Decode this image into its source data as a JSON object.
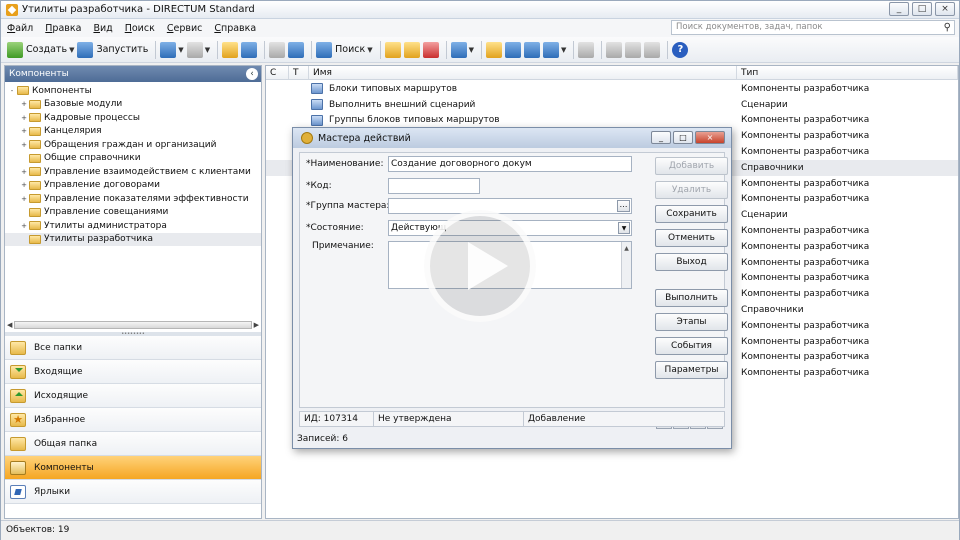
{
  "window": {
    "title": "Утилиты разработчика - DIRECTUM Standard",
    "controls": [
      "_",
      "□",
      "×"
    ]
  },
  "menu": [
    "Файл",
    "Правка",
    "Вид",
    "Поиск",
    "Сервис",
    "Справка"
  ],
  "search": {
    "placeholder": "Поиск документов, задач, папок"
  },
  "toolbar": {
    "create_label": "Создать",
    "run_label": "Запустить",
    "search_label": "Поиск"
  },
  "left_pane": {
    "header": "Компоненты",
    "tree": [
      {
        "label": "Компоненты",
        "level": 0,
        "expand": "-"
      },
      {
        "label": "Базовые модули",
        "level": 1,
        "expand": "+"
      },
      {
        "label": "Кадровые процессы",
        "level": 1,
        "expand": "+"
      },
      {
        "label": "Канцелярия",
        "level": 1,
        "expand": "+"
      },
      {
        "label": "Обращения граждан и организаций",
        "level": 1,
        "expand": "+"
      },
      {
        "label": "Общие справочники",
        "level": 1,
        "expand": ""
      },
      {
        "label": "Управление взаимодействием с клиентами",
        "level": 1,
        "expand": "+"
      },
      {
        "label": "Управление договорами",
        "level": 1,
        "expand": "+"
      },
      {
        "label": "Управление показателями эффективности",
        "level": 1,
        "expand": "+"
      },
      {
        "label": "Управление совещаниями",
        "level": 1,
        "expand": ""
      },
      {
        "label": "Утилиты администратора",
        "level": 1,
        "expand": "+"
      },
      {
        "label": "Утилиты разработчика",
        "level": 1,
        "expand": ""
      }
    ],
    "nav": [
      {
        "label": "Все папки",
        "icon": "folder-icon"
      },
      {
        "label": "Входящие",
        "icon": "inbox-icon"
      },
      {
        "label": "Исходящие",
        "icon": "outbox-icon"
      },
      {
        "label": "Избранное",
        "icon": "favorites-icon"
      },
      {
        "label": "Общая папка",
        "icon": "shared-folder-icon"
      },
      {
        "label": "Компоненты",
        "icon": "components-icon",
        "active": true
      },
      {
        "label": "Ярлыки",
        "icon": "shortcuts-icon"
      }
    ]
  },
  "grid": {
    "columns": {
      "c": "С",
      "t": "Т",
      "name": "Имя",
      "type": "Тип"
    },
    "rows": [
      {
        "name": "Блоки типовых маршрутов",
        "type": "Компоненты разработчика"
      },
      {
        "name": "Выполнить внешний сценарий",
        "type": "Сценарии"
      },
      {
        "name": "Группы блоков типовых маршрутов",
        "type": "Компоненты разработчика"
      },
      {
        "name": "",
        "type": "Компоненты разработчика"
      },
      {
        "name": "",
        "type": "Компоненты разработчика"
      },
      {
        "name": "",
        "type": "Справочники",
        "sel": true
      },
      {
        "name": "",
        "type": "Компоненты разработчика"
      },
      {
        "name": "",
        "type": "Компоненты разработчика"
      },
      {
        "name": "",
        "type": "Сценарии"
      },
      {
        "name": "",
        "type": "Компоненты разработчика"
      },
      {
        "name": "",
        "type": "Компоненты разработчика"
      },
      {
        "name": "",
        "type": "Компоненты разработчика"
      },
      {
        "name": "",
        "type": "Компоненты разработчика"
      },
      {
        "name": "",
        "type": "Компоненты разработчика"
      },
      {
        "name": "",
        "type": "Справочники"
      },
      {
        "name": "",
        "type": "Компоненты разработчика"
      },
      {
        "name": "",
        "type": "Компоненты разработчика"
      },
      {
        "name": "",
        "type": "Компоненты разработчика"
      },
      {
        "name": "",
        "type": "Компоненты разработчика"
      }
    ]
  },
  "status": {
    "objects": "Объектов: 19"
  },
  "dialog": {
    "title": "Мастера действий",
    "fields": {
      "name_label": "*Наименование:",
      "name_value": "Создание договорного докум",
      "code_label": "*Код:",
      "code_value": "",
      "group_label": "*Группа мастера:",
      "group_value": "",
      "state_label": "*Состояние:",
      "state_value": "Действующ",
      "note_label": "Примечание:",
      "note_value": ""
    },
    "buttons": {
      "add": "Добавить",
      "delete": "Удалить",
      "save": "Сохранить",
      "cancel": "Отменить",
      "exit": "Выход",
      "execute": "Выполнить",
      "stages": "Этапы",
      "events": "События",
      "params": "Параметры"
    },
    "status": {
      "id": "ИД: 107314",
      "approval": "Не утверждена",
      "mode": "Добавление"
    },
    "records": "Записей: 6"
  }
}
